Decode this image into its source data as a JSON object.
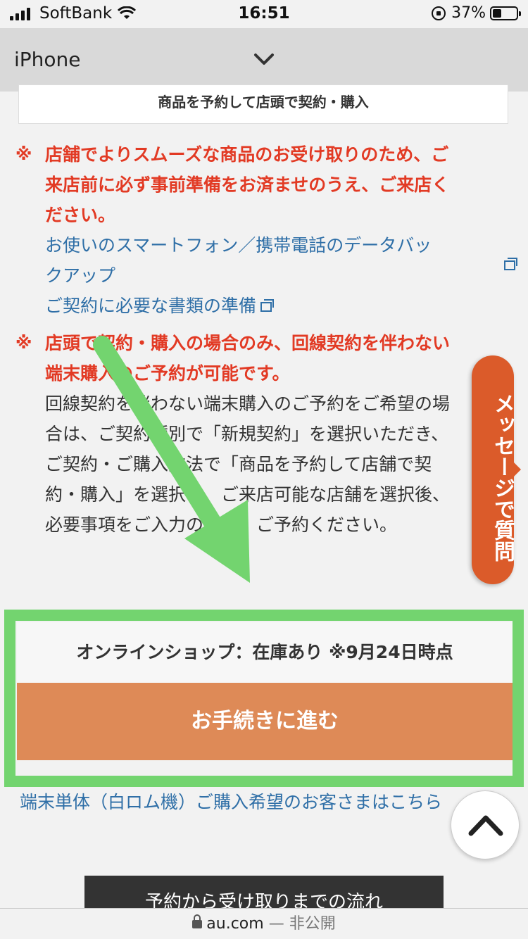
{
  "status_bar": {
    "carrier": "SoftBank",
    "time": "16:51",
    "battery": "37%",
    "battery_level": 0.37
  },
  "header": {
    "title": "iPhone"
  },
  "option": {
    "label": "商品を予約して店頭で契約・購入"
  },
  "notice1": {
    "mark": "※",
    "lines": [
      "店舗でよりスムーズな商品のお受け取りのため、ご",
      "来店前に必ず事前準備をお済ませのうえ、ご来店く",
      "ださい。"
    ],
    "link1_lines": [
      "お使いのスマートフォン／携帯電話のデータバッ",
      "クアップ"
    ],
    "link2": "ご契約に必要な書類の準備"
  },
  "notice2": {
    "mark": "※",
    "lines": [
      "店頭で契約・購入の場合のみ、回線契約を伴わない",
      "端末購入のご予約が可能です。"
    ],
    "body": [
      "回線契約を伴わない端末購入のご予約をご希望の場",
      "合は、ご契約種別で「新規契約」を選択いただき、",
      "ご契約・ご購入方法で「商品を予約して店舗で契",
      "約・購入」を選択し、ご来店可能な店舗を選択後、",
      "必要事項をご入力のうえ、ご予約ください。"
    ]
  },
  "message_tab": {
    "label": "メッセージで質問"
  },
  "stock": {
    "text": "オンラインショップ：在庫あり ※9月24日時点"
  },
  "proceed": {
    "label": "お手続きに進む"
  },
  "device_link": {
    "text": "端末単体（白ロム機）ご購入希望のお客さまはこちら"
  },
  "flow_button": {
    "label": "予約から受け取りまでの流れ"
  },
  "url_bar": {
    "domain": "au.com",
    "separator": "—",
    "status": "非公開"
  },
  "colors": {
    "accent_red": "#e23a24",
    "link_blue": "#2f6fa7",
    "proceed_orange": "#de8a57",
    "message_orange": "#db5b2a",
    "annotation_green": "#73d46f"
  },
  "icons": {
    "header_toggle": "chevron-down-icon",
    "external_link": "external-link-icon",
    "scroll_top": "chevron-up-icon",
    "secure": "lock-icon",
    "annotation": "arrow-annotation-icon"
  }
}
